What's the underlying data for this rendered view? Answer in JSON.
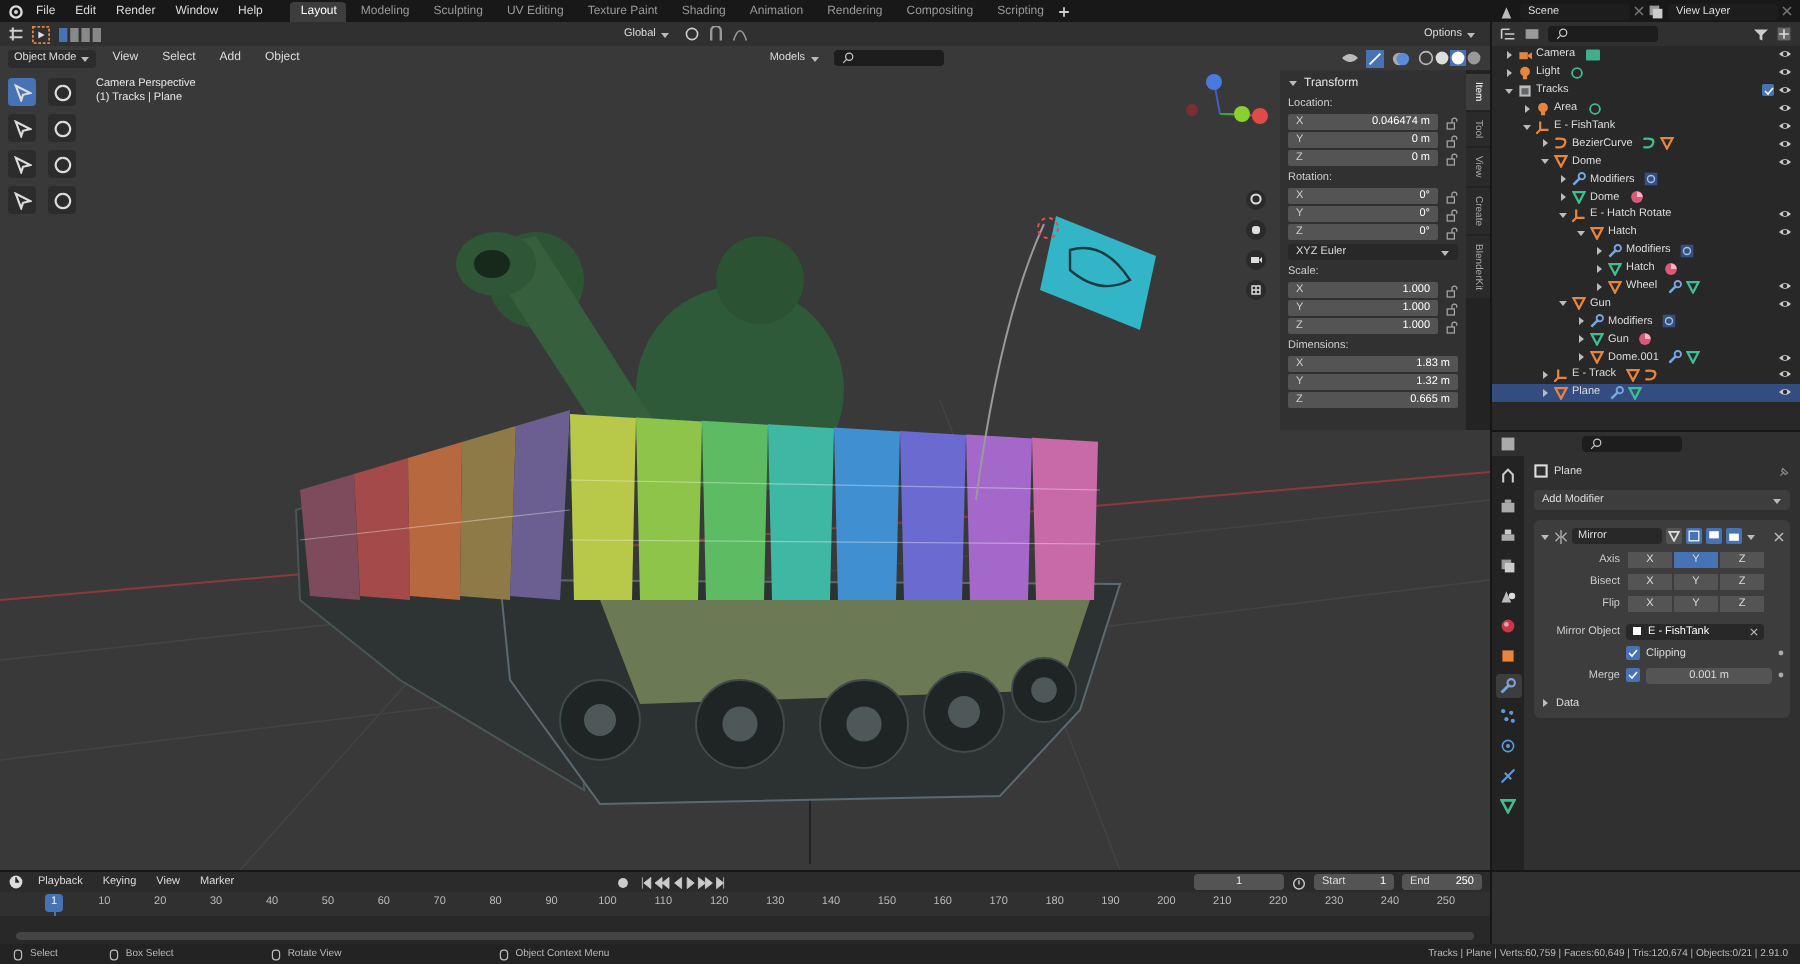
{
  "menu": [
    "File",
    "Edit",
    "Render",
    "Window",
    "Help"
  ],
  "workspaces": [
    {
      "label": "Layout",
      "selected": true
    },
    {
      "label": "Modeling",
      "selected": false
    },
    {
      "label": "Sculpting",
      "selected": false
    },
    {
      "label": "UV Editing",
      "selected": false
    },
    {
      "label": "Texture Paint",
      "selected": false
    },
    {
      "label": "Shading",
      "selected": false
    },
    {
      "label": "Animation",
      "selected": false
    },
    {
      "label": "Rendering",
      "selected": false
    },
    {
      "label": "Compositing",
      "selected": false
    },
    {
      "label": "Scripting",
      "selected": false
    }
  ],
  "scene": {
    "value": "Scene"
  },
  "view_layer": {
    "value": "View Layer"
  },
  "tool_header": {
    "orientation": "Global",
    "options": "Options"
  },
  "viewport_header": {
    "mode": "Object Mode",
    "menus": [
      "View",
      "Select",
      "Add",
      "Object"
    ],
    "collection": "Models"
  },
  "viewport": {
    "view_name": "Camera Perspective",
    "context": "(1) Tracks | Plane"
  },
  "sidebar": {
    "tabs": [
      {
        "label": "Item",
        "selected": true
      },
      {
        "label": "Tool",
        "selected": false
      },
      {
        "label": "View",
        "selected": false
      },
      {
        "label": "Create",
        "selected": false
      },
      {
        "label": "BlenderKit",
        "selected": false
      }
    ],
    "panel_title": "Transform",
    "groups": [
      {
        "kind": "fields",
        "label": "Location:",
        "locks": true,
        "rows": [
          {
            "axis": "X",
            "value": "0.046474 m"
          },
          {
            "axis": "Y",
            "value": "0 m"
          },
          {
            "axis": "Z",
            "value": "0 m"
          }
        ]
      },
      {
        "kind": "fields",
        "label": "Rotation:",
        "locks": true,
        "rows": [
          {
            "axis": "X",
            "value": "0°"
          },
          {
            "axis": "Y",
            "value": "0°"
          },
          {
            "axis": "Z",
            "value": "0°"
          }
        ]
      },
      {
        "kind": "dropdown",
        "value": "XYZ Euler"
      },
      {
        "kind": "fields",
        "label": "Scale:",
        "locks": true,
        "rows": [
          {
            "axis": "X",
            "value": "1.000"
          },
          {
            "axis": "Y",
            "value": "1.000"
          },
          {
            "axis": "Z",
            "value": "1.000"
          }
        ]
      },
      {
        "kind": "fields",
        "label": "Dimensions:",
        "locks": false,
        "rows": [
          {
            "axis": "X",
            "value": "1.83 m"
          },
          {
            "axis": "Y",
            "value": "1.32 m"
          },
          {
            "axis": "Z",
            "value": "0.665 m"
          }
        ]
      }
    ]
  },
  "outliner": {
    "items": [
      {
        "name": "Camera",
        "kind": "camera",
        "extras": [
          {
            "kind": "camera_data"
          }
        ],
        "expanded": false,
        "visible": true,
        "selected": false
      },
      {
        "name": "Light",
        "kind": "light",
        "extras": [
          {
            "kind": "light_data"
          }
        ],
        "expanded": false,
        "visible": true,
        "selected": false
      },
      {
        "name": "Tracks",
        "kind": "collection",
        "expanded": true,
        "visible": true,
        "selected": false,
        "checked": true,
        "children": [
          {
            "name": "Area",
            "kind": "light",
            "extras": [
              {
                "kind": "light_data"
              }
            ],
            "expanded": false,
            "visible": true,
            "selected": false
          },
          {
            "name": "E - FishTank",
            "kind": "empty",
            "expanded": true,
            "visible": true,
            "selected": false,
            "children": [
              {
                "name": "BezierCurve",
                "kind": "curve",
                "extras": [
                  {
                    "kind": "curve_data"
                  },
                  {
                    "kind": "mesh"
                  }
                ],
                "expanded": false,
                "visible": true,
                "selected": false
              },
              {
                "name": "Dome",
                "kind": "mesh",
                "expanded": true,
                "visible": true,
                "selected": false,
                "children": [
                  {
                    "name": "Modifiers",
                    "kind": "modifiers",
                    "extras": [
                      {
                        "kind": "modifier"
                      }
                    ],
                    "expanded": false,
                    "visible": false,
                    "selected": false
                  },
                  {
                    "name": "Dome",
                    "kind": "mesh_data",
                    "extras": [
                      {
                        "kind": "material"
                      }
                    ],
                    "expanded": false,
                    "visible": false,
                    "selected": false
                  },
                  {
                    "name": "E - Hatch Rotate",
                    "kind": "empty",
                    "expanded": true,
                    "visible": true,
                    "selected": false,
                    "children": [
                      {
                        "name": "Hatch",
                        "kind": "mesh",
                        "expanded": true,
                        "visible": true,
                        "selected": false,
                        "children": [
                          {
                            "name": "Modifiers",
                            "kind": "modifiers",
                            "extras": [
                              {
                                "kind": "modifier"
                              }
                            ],
                            "expanded": false,
                            "visible": false,
                            "selected": false
                          },
                          {
                            "name": "Hatch",
                            "kind": "mesh_data",
                            "extras": [
                              {
                                "kind": "material"
                              }
                            ],
                            "expanded": false,
                            "visible": false,
                            "selected": false
                          },
                          {
                            "name": "Wheel",
                            "kind": "mesh",
                            "extras": [
                              {
                                "kind": "modifiers"
                              },
                              {
                                "kind": "mesh_data"
                              }
                            ],
                            "expanded": false,
                            "visible": true,
                            "selected": false
                          }
                        ]
                      }
                    ]
                  },
                  {
                    "name": "Gun",
                    "kind": "mesh",
                    "expanded": true,
                    "visible": true,
                    "selected": false,
                    "children": [
                      {
                        "name": "Modifiers",
                        "kind": "modifiers",
                        "extras": [
                          {
                            "kind": "modifier"
                          }
                        ],
                        "expanded": false,
                        "visible": false,
                        "selected": false
                      },
                      {
                        "name": "Gun",
                        "kind": "mesh_data",
                        "extras": [
                          {
                            "kind": "material"
                          }
                        ],
                        "expanded": false,
                        "visible": false,
                        "selected": false
                      },
                      {
                        "name": "Dome.001",
                        "kind": "mesh",
                        "extras": [
                          {
                            "kind": "modifiers"
                          },
                          {
                            "kind": "mesh_data"
                          }
                        ],
                        "expanded": false,
                        "visible": true,
                        "selected": false
                      }
                    ]
                  }
                ]
              },
              {
                "name": "E - Track",
                "kind": "empty",
                "extras": [
                  {
                    "kind": "mesh"
                  },
                  {
                    "kind": "curve"
                  }
                ],
                "expanded": false,
                "visible": true,
                "selected": false
              },
              {
                "name": "Plane",
                "kind": "mesh",
                "extras": [
                  {
                    "kind": "modifiers"
                  },
                  {
                    "kind": "mesh_data"
                  }
                ],
                "expanded": false,
                "visible": true,
                "selected": true
              }
            ]
          }
        ]
      }
    ]
  },
  "properties": {
    "tabs": [
      {
        "kind": "tool",
        "selected": false
      },
      {
        "kind": "render",
        "selected": false
      },
      {
        "kind": "output",
        "selected": false
      },
      {
        "kind": "view_layer",
        "selected": false
      },
      {
        "kind": "scene",
        "selected": false
      },
      {
        "kind": "world",
        "selected": false
      },
      {
        "kind": "object",
        "selected": false
      },
      {
        "kind": "modifiers",
        "selected": true
      },
      {
        "kind": "particles",
        "selected": false
      },
      {
        "kind": "physics",
        "selected": false
      },
      {
        "kind": "constraints",
        "selected": false
      },
      {
        "kind": "data",
        "selected": false
      }
    ],
    "object_name": "Plane",
    "add_modifier": "Add Modifier",
    "modifier": {
      "name": "Mirror",
      "expanded": true,
      "rows": [
        {
          "kind": "toggles",
          "label": "Axis",
          "options": [
            {
              "label": "X",
              "selected": false
            },
            {
              "label": "Y",
              "selected": true
            },
            {
              "label": "Z",
              "selected": false
            }
          ]
        },
        {
          "kind": "toggles",
          "label": "Bisect",
          "options": [
            {
              "label": "X",
              "selected": false
            },
            {
              "label": "Y",
              "selected": false
            },
            {
              "label": "Z",
              "selected": false
            }
          ]
        },
        {
          "kind": "toggles",
          "label": "Flip",
          "options": [
            {
              "label": "X",
              "selected": false
            },
            {
              "label": "Y",
              "selected": false
            },
            {
              "label": "Z",
              "selected": false
            }
          ]
        },
        {
          "kind": "object",
          "label": "Mirror Object",
          "value": "E - FishTank"
        },
        {
          "kind": "checkbox",
          "label": "Clipping",
          "checked": true
        },
        {
          "kind": "number",
          "label": "Merge",
          "checked": true,
          "value": "0.001 m"
        }
      ]
    },
    "subpanel": {
      "label": "Data",
      "expanded": false
    }
  },
  "timeline": {
    "menus": [
      "Playback",
      "Keying",
      "View",
      "Marker"
    ],
    "current_frame": "1",
    "start_label": "Start",
    "start": "1",
    "end_label": "End",
    "end": "250",
    "playhead": "1",
    "ruler": [
      "10",
      "20",
      "30",
      "40",
      "50",
      "60",
      "70",
      "80",
      "90",
      "100",
      "110",
      "120",
      "130",
      "140",
      "150",
      "160",
      "170",
      "180",
      "190",
      "200",
      "210",
      "220",
      "230",
      "240",
      "250"
    ]
  },
  "status_bar": {
    "hints": [
      "Select",
      "Box Select",
      "Rotate View",
      "Object Context Menu"
    ],
    "stats": "Tracks | Plane | Verts:60,759 | Faces:60,649 | Tris:120,674 | Objects:0/21 | 2.91.0"
  }
}
